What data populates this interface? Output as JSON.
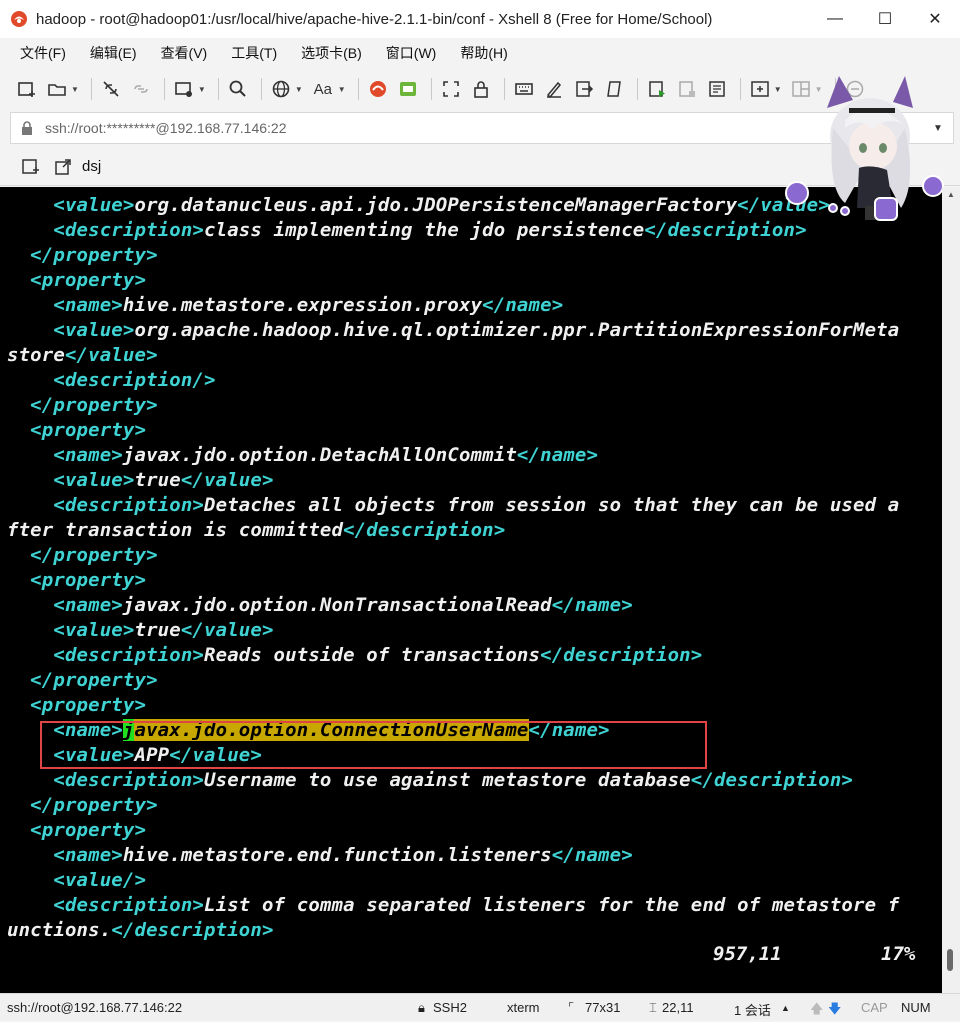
{
  "window": {
    "title": "hadoop - root@hadoop01:/usr/local/hive/apache-hive-2.1.1-bin/conf - Xshell 8 (Free for Home/School)",
    "minimize": "—",
    "maximize": "☐",
    "close": "✕"
  },
  "menu": [
    "文件(F)",
    "编辑(E)",
    "查看(V)",
    "工具(T)",
    "选项卡(B)",
    "窗口(W)",
    "帮助(H)"
  ],
  "address": {
    "text": "ssh://root:*********@192.168.77.146:22"
  },
  "session_tab": {
    "label": "dsj"
  },
  "terminal": {
    "lines": [
      [
        [
          "tag",
          "    <value>"
        ],
        [
          "txt",
          "org.datanucleus.api.jdo.JDOPersistenceManagerFactory"
        ],
        [
          "tag",
          "</value>"
        ]
      ],
      [
        [
          "tag",
          "    <description>"
        ],
        [
          "txt",
          "class implementing the jdo persistence"
        ],
        [
          "tag",
          "</description>"
        ]
      ],
      [
        [
          "tag",
          "  </property>"
        ]
      ],
      [
        [
          "tag",
          "  <property>"
        ]
      ],
      [
        [
          "tag",
          "    <name>"
        ],
        [
          "txt",
          "hive.metastore.expression.proxy"
        ],
        [
          "tag",
          "</name>"
        ]
      ],
      [
        [
          "tag",
          "    <value>"
        ],
        [
          "txt",
          "org.apache.hadoop.hive.ql.optimizer.ppr.PartitionExpressionForMeta"
        ]
      ],
      [
        [
          "txt",
          "store"
        ],
        [
          "tag",
          "</value>"
        ]
      ],
      [
        [
          "tag",
          "    <description/>"
        ]
      ],
      [
        [
          "tag",
          "  </property>"
        ]
      ],
      [
        [
          "tag",
          "  <property>"
        ]
      ],
      [
        [
          "tag",
          "    <name>"
        ],
        [
          "txt",
          "javax.jdo.option.DetachAllOnCommit"
        ],
        [
          "tag",
          "</name>"
        ]
      ],
      [
        [
          "tag",
          "    <value>"
        ],
        [
          "txt",
          "true"
        ],
        [
          "tag",
          "</value>"
        ]
      ],
      [
        [
          "tag",
          "    <description>"
        ],
        [
          "txt",
          "Detaches all objects from session so that they can be used a"
        ]
      ],
      [
        [
          "txt",
          "fter transaction is committed"
        ],
        [
          "tag",
          "</description>"
        ]
      ],
      [
        [
          "tag",
          "  </property>"
        ]
      ],
      [
        [
          "tag",
          "  <property>"
        ]
      ],
      [
        [
          "tag",
          "    <name>"
        ],
        [
          "txt",
          "javax.jdo.option.NonTransactionalRead"
        ],
        [
          "tag",
          "</name>"
        ]
      ],
      [
        [
          "tag",
          "    <value>"
        ],
        [
          "txt",
          "true"
        ],
        [
          "tag",
          "</value>"
        ]
      ],
      [
        [
          "tag",
          "    <description>"
        ],
        [
          "txt",
          "Reads outside of transactions"
        ],
        [
          "tag",
          "</description>"
        ]
      ],
      [
        [
          "tag",
          "  </property>"
        ]
      ],
      [
        [
          "tag",
          "  <property>"
        ]
      ],
      [
        [
          "tag",
          "    <name>"
        ],
        [
          "cursor",
          "j"
        ],
        [
          "hl",
          "avax.jdo.option.ConnectionUserName"
        ],
        [
          "tag",
          "</name>"
        ]
      ],
      [
        [
          "tag",
          "    <value>"
        ],
        [
          "txt",
          "APP"
        ],
        [
          "tag",
          "</value>"
        ]
      ],
      [
        [
          "tag",
          "    <description>"
        ],
        [
          "txt",
          "Username to use against metastore database"
        ],
        [
          "tag",
          "</description>"
        ]
      ],
      [
        [
          "tag",
          "  </property>"
        ]
      ],
      [
        [
          "tag",
          "  <property>"
        ]
      ],
      [
        [
          "tag",
          "    <name>"
        ],
        [
          "txt",
          "hive.metastore.end.function.listeners"
        ],
        [
          "tag",
          "</name>"
        ]
      ],
      [
        [
          "tag",
          "    <value/>"
        ]
      ],
      [
        [
          "tag",
          "    <description>"
        ],
        [
          "txt",
          "List of comma separated listeners for the end of metastore f"
        ]
      ],
      [
        [
          "txt",
          "unctions."
        ],
        [
          "tag",
          "</description>"
        ]
      ]
    ],
    "status_position": "957,11",
    "status_percent": "17%"
  },
  "statusbar": {
    "connection": "ssh://root@192.168.77.146:22",
    "protocol": "SSH2",
    "terminal_type": "xterm",
    "size": "77x31",
    "cursor": "22,11",
    "sessions": "1 会话",
    "cap": "CAP",
    "num": "NUM"
  },
  "colors": {
    "terminal_bg": "#000000",
    "tag": "#3fd3d3",
    "text": "#f0f0f0",
    "highlight": "#c8a800",
    "cursor": "#20e020",
    "annotation_box": "#e04545"
  }
}
